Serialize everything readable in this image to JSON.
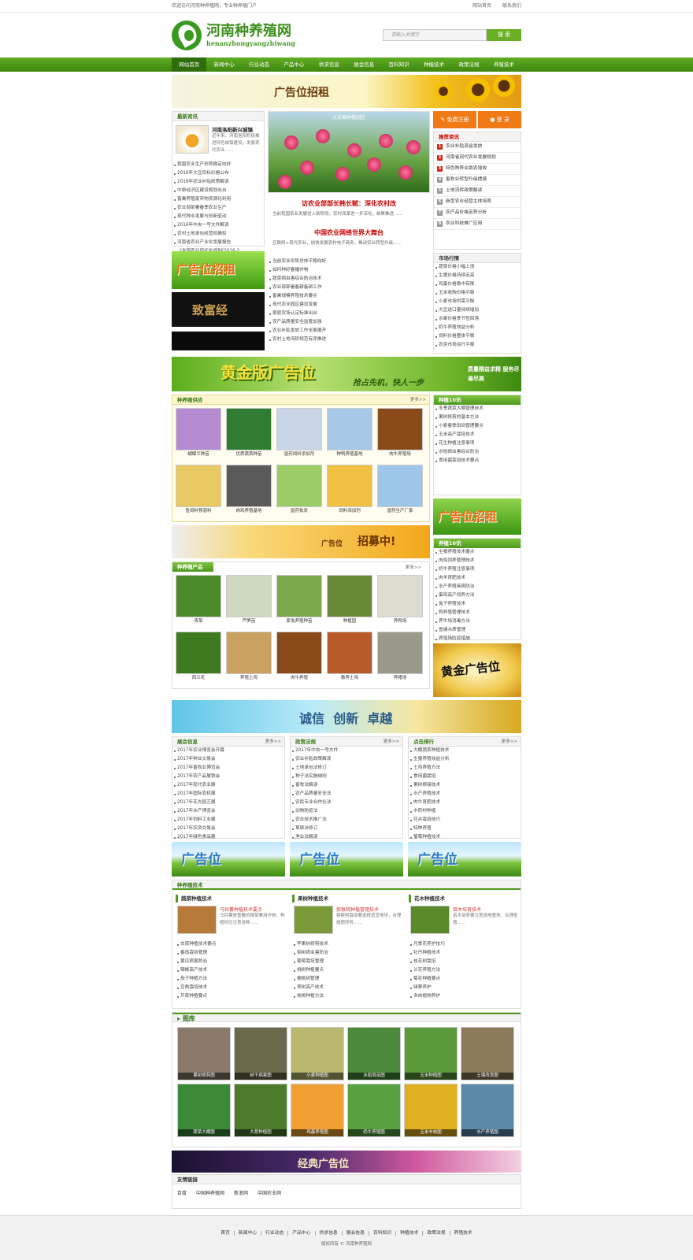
{
  "top": {
    "left": "欢迎访问河南种养殖网，专业种养殖门户",
    "links": [
      "网站首页",
      "联系我们"
    ]
  },
  "logo": {
    "cn": "河南种养殖网",
    "en": "henanzhongyangzhiwang"
  },
  "search": {
    "placeholder": "请输入关键字",
    "button": "搜 索"
  },
  "nav": [
    "网站首页",
    "新闻中心",
    "行业动态",
    "产品中心",
    "供求信息",
    "展会信息",
    "百科知识",
    "种植技术",
    "政策法规",
    "养殖技术"
  ],
  "banner_top": "广告位招租",
  "news_box": {
    "title": "最新资讯",
    "feature_title": "河南洛阳新兴城镇",
    "feature_desc": "近年来，河南洛阳积极推进特色城镇建设，发展现代农业……",
    "items": [
      "我国农业生产形势稳定向好",
      "2016年大豆目标价格公布",
      "2016年农业补贴政策解读",
      "中原经济区建设规划出台",
      "畜禽养殖废弃物资源化利用",
      "农业部部署春季农业生产",
      "现代种业发展与创新驱动",
      "2016年中央一号文件解读",
      "农村土地承包经营权确权",
      "河南省农业产业化发展报告",
      "《全国农业现代化规划(2016-2"
    ]
  },
  "side_ads": [
    "广告位招租",
    "致富经"
  ],
  "slide_caption": "火龙果种植园区",
  "center": {
    "h1": "访农业部部长韩长赋：深化农村改",
    "h1desc": "当前我国农业发展进入新阶段，农村改革进一步深化，统筹推进……",
    "h2": "中国农业网络世界大舞台",
    "h2desc": "互联网+现代农业，加快发展农村电子商务，推动农业转型升级……",
    "items": [
      "当前农业形势总体平稳向好",
      "如何种好春播作物",
      "蔬菜病虫害综合防治技术",
      "农业部部署春耕备耕工作",
      "畜禽规模养殖技术要点",
      "现代农业园区建设发展",
      "家庭农场认定标准出台",
      "农产品质量安全监管加强",
      "农业补贴发放工作全面展开",
      "农村土地流转规范有序推进"
    ]
  },
  "login": {
    "register": "免费注册",
    "login": "登 录"
  },
  "hot": {
    "title": "推荐资讯",
    "items": [
      "农业补贴资金发放",
      "河南省现代农业发展规划",
      "特色种养业助农增收",
      "畜牧业转型升级提速",
      "土地流转政策解读",
      "新型农业经营主体培育",
      "农产品价格走势分析",
      "农业科技推广应用"
    ]
  },
  "market": {
    "title": "市场行情",
    "items": [
      "蔬菜价格小幅上涨",
      "生猪价格持续走高",
      "鸡蛋价格稳中有降",
      "玉米收购价格平稳",
      "小麦市场供需平衡",
      "大豆进口量持续增加",
      "水果价格季节性回落",
      "奶牛养殖效益分析",
      "饲料价格整体平稳",
      "农资市场运行平稳"
    ]
  },
  "gold_ad": {
    "main": "黄金版广告位",
    "sub": "抢占先机，快人一步",
    "right": "质量精益求精 服务尽善尽美"
  },
  "products": {
    "title": "种养殖供应",
    "more": "更多>>",
    "items": [
      "蝴蝶兰种苗",
      "优质蔬菜种苗",
      "兽药饲料添加剂",
      "种鸭养殖基地",
      "肉牛养殖场",
      "鱼饲料预混料",
      "肉鸡养殖基地",
      "兽药批发",
      "饲料添加剂",
      "兽药生产厂家"
    ]
  },
  "ad_recruit": {
    "text": "广告位",
    "strong": "招募中!"
  },
  "tech10": {
    "title": "种植10讯",
    "items": [
      "冬季蔬菜大棚管理技术",
      "果树修剪的基本方法",
      "小麦春季田间管理要点",
      "玉米高产栽培技术",
      "花生种植注意事项",
      "水稻病虫害综合防治",
      "食用菌栽培技术要点"
    ]
  },
  "animals": {
    "title": "种养殖产品",
    "more": "更多>>",
    "items": [
      "青菜",
      "芦笋苗",
      "家兔养殖种苗",
      "种植园",
      "养鸭场",
      "西兰花",
      "养殖土鸡",
      "肉牛养殖",
      "散养土鸡",
      "养猪场"
    ]
  },
  "breed10": {
    "title": "养殖10讯",
    "items": [
      "生猪养殖技术要点",
      "肉鸡饲养管理技术",
      "奶牛养殖注意事项",
      "肉羊育肥技术",
      "水产养殖疾病防治",
      "蛋鸡高产饲养方法",
      "兔子养殖技术",
      "鸭养殖管理技术",
      "养牛场消毒方法",
      "鱼塘水质管理",
      "养殖场防疫措施"
    ]
  },
  "ad_gold2": "黄金广告位",
  "ad_slogan": "诚信  创新  卓越",
  "lists3": [
    {
      "title": "展会信息",
      "more": "更多>>",
      "items": [
        "2017年农业博览会开幕",
        "2017年种业交易会",
        "2017年畜牧业博览会",
        "2017年农产品展销会",
        "2017年现代农业展",
        "2017年国际农机展",
        "2017年花卉园艺展",
        "2017年水产博览会",
        "2017年饲料工业展",
        "2017年农资交易会",
        "2017年绿色食品展"
      ]
    },
    {
      "title": "政策法规",
      "more": "更多>>",
      "items": [
        "2017年中央一号文件",
        "农业补贴政策解读",
        "土地承包法修订",
        "种子法实施细则",
        "畜牧法解读",
        "农产品质量安全法",
        "农民专业合作社法",
        "动物防疫法",
        "农业技术推广法",
        "草原法修订",
        "渔业法解读"
      ]
    },
    {
      "title": "点击排行",
      "more": "更多>>",
      "items": [
        "大棚蔬菜种植技术",
        "生猪养殖效益分析",
        "土鸡养殖方法",
        "食用菌栽培",
        "果树嫁接技术",
        "水产养殖技术",
        "肉牛育肥技术",
        "中药材种植",
        "花卉栽培技巧",
        "特种养殖",
        "葡萄种植技术"
      ]
    }
  ],
  "ads3": [
    "广告位",
    "广告位",
    "广告位"
  ],
  "tech": {
    "title": "种养殖技术",
    "cols": [
      {
        "title": "蔬菜种植技术",
        "ftitle": "马铃薯种植技术要点",
        "fdesc": "马铃薯是重要的粮菜兼用作物，种植时应注意选种……",
        "items": [
          "白菜种植技术要点",
          "番茄栽培管理",
          "黄瓜病害防治",
          "辣椒高产技术",
          "茄子种植方法",
          "豆角栽培技术",
          "芹菜种植要点"
        ]
      },
      {
        "title": "果树种植技术",
        "ftitle": "猕猴桃种植管理技术",
        "fdesc": "猕猴桃栽培要选择适宜地块，合理施肥修剪……",
        "items": [
          "苹果树修剪技术",
          "梨树病虫害防治",
          "葡萄栽培管理",
          "桃树种植要点",
          "樱桃树管理",
          "枣树高产技术",
          "核桃种植方法"
        ]
      },
      {
        "title": "花木种植技术",
        "ftitle": "苗木培育技术",
        "fdesc": "苗木培育要注意选地整地、合理密植……",
        "items": [
          "月季花养护技巧",
          "牡丹种植技术",
          "桂花树栽培",
          "兰花养殖方法",
          "菊花种植要点",
          "绿萝养护",
          "多肉植物养护"
        ]
      }
    ]
  },
  "gallery": {
    "title": "图库",
    "items": [
      "果树修剪图",
      "树干病害图",
      "小麦种植图",
      "水稻育苗图",
      "玉米种植图",
      "土壤改良图",
      "蔬菜大棚图",
      "大葱种植图",
      "鸡蛋养殖图",
      "奶牛养殖图",
      "玉米丰收图",
      "水产养殖图"
    ]
  },
  "ad_classic": "经典广告位",
  "friend": {
    "title": "友情链接",
    "items": [
      "百度",
      "中国种养殖网",
      "新浪网",
      "中国农业网"
    ]
  },
  "footer": {
    "links": [
      "首页",
      "新闻中心",
      "行业动态",
      "产品中心",
      "供求信息",
      "展会信息",
      "百科知识",
      "种植技术",
      "政策法规",
      "养殖技术"
    ],
    "copyright": "版权所有 © 河南种养殖网"
  }
}
